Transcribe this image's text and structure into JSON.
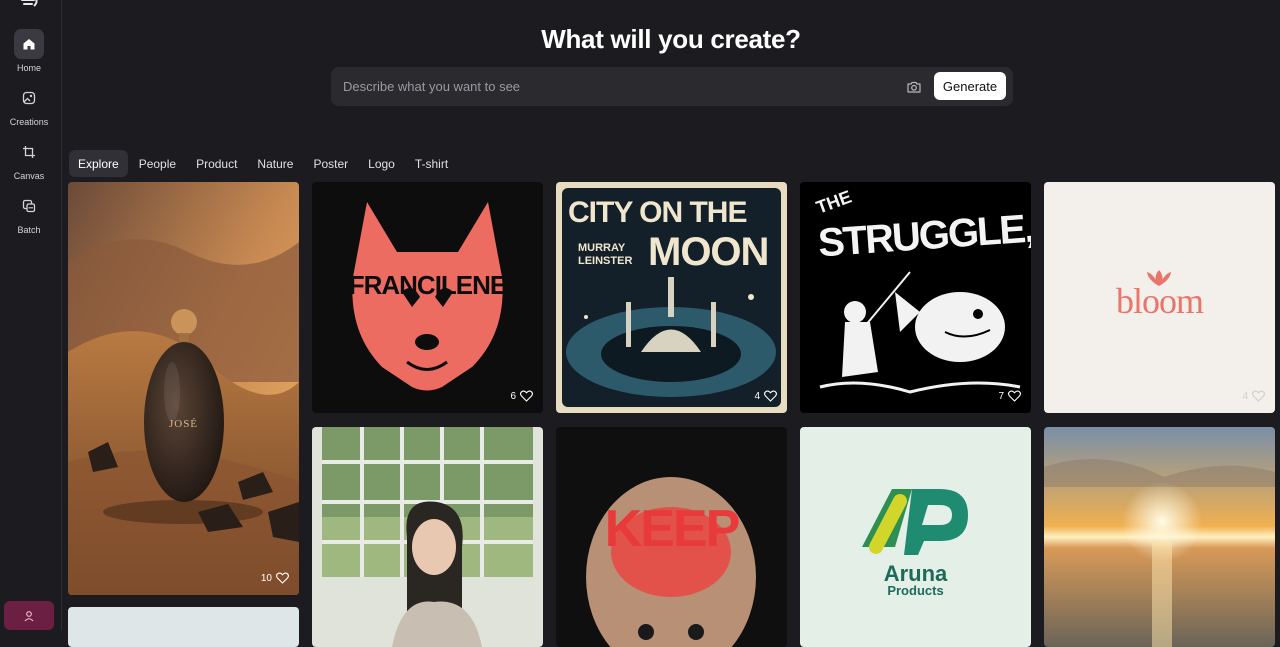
{
  "headline": "What will you create?",
  "search": {
    "placeholder": "Describe what you want to see",
    "value": "",
    "generate_label": "Generate"
  },
  "sidebar": {
    "items": [
      {
        "label": "Home",
        "icon": "home-icon",
        "active": true
      },
      {
        "label": "Creations",
        "icon": "image-icon",
        "active": false
      },
      {
        "label": "Canvas",
        "icon": "crop-icon",
        "active": false
      },
      {
        "label": "Batch",
        "icon": "batch-icon",
        "active": false
      }
    ]
  },
  "tabs": [
    {
      "label": "Explore",
      "active": true
    },
    {
      "label": "People",
      "active": false
    },
    {
      "label": "Product",
      "active": false
    },
    {
      "label": "Nature",
      "active": false
    },
    {
      "label": "Poster",
      "active": false
    },
    {
      "label": "Logo",
      "active": false
    },
    {
      "label": "T-shirt",
      "active": false
    }
  ],
  "gallery": [
    {
      "name": "perfume-desert",
      "likes": "10",
      "text": "JOSÉ"
    },
    {
      "name": "wolf-logo",
      "likes": "6",
      "text": "FRANCILENE"
    },
    {
      "name": "city-on-the-moon",
      "likes": "4",
      "text_top": "CITY ON THE",
      "text_small_1": "MURRAY",
      "text_small_2": "LEINSTER",
      "text_big": "MOON"
    },
    {
      "name": "the-struggle",
      "likes": "7",
      "text_top": "THE",
      "text_big": "STRUGGLE,"
    },
    {
      "name": "bloom-logo",
      "likes": "4",
      "text": "bloom"
    },
    {
      "name": "woman-window",
      "likes": ""
    },
    {
      "name": "keep-it",
      "likes": "",
      "text": "KEEP"
    },
    {
      "name": "aruna-logo",
      "likes": "",
      "text_1": "Aruna",
      "text_2": "Products"
    },
    {
      "name": "sunset-sea",
      "likes": ""
    },
    {
      "name": "partial-card",
      "likes": ""
    }
  ],
  "colors": {
    "background": "#1c1c20",
    "accent_profile": "#6b2043",
    "wolf": "#ec6c62",
    "bloom": "#e8766a"
  }
}
